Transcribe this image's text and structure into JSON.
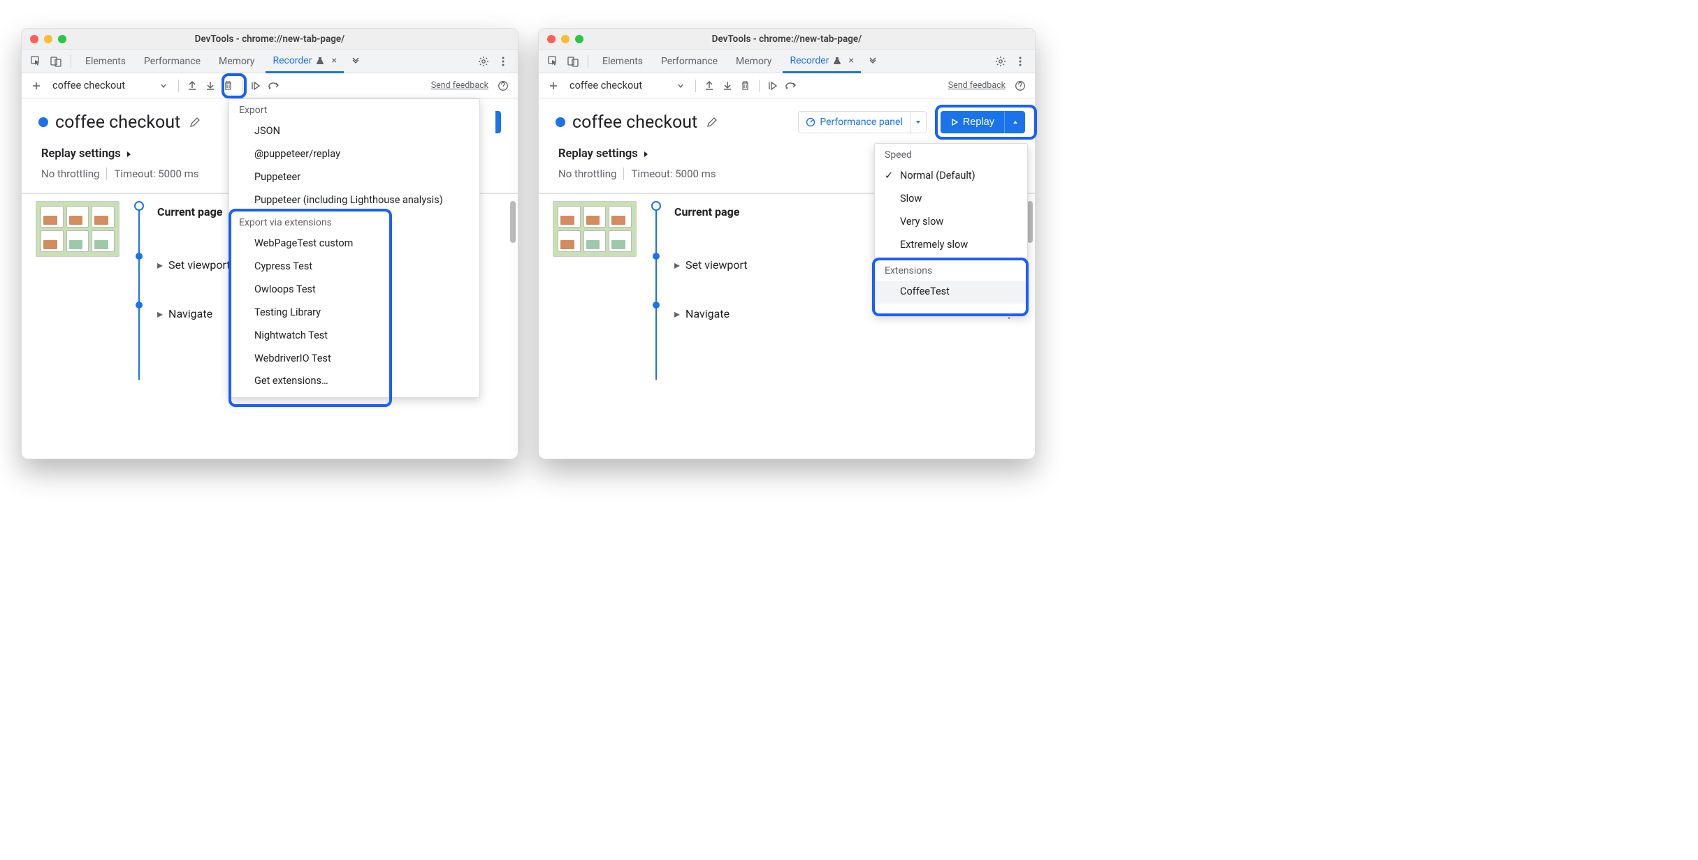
{
  "titlebar": {
    "title": "DevTools - chrome://new-tab-page/"
  },
  "tabs": {
    "elements": "Elements",
    "performance": "Performance",
    "memory": "Memory",
    "recorder": "Recorder"
  },
  "toolbar": {
    "recording_name": "coffee checkout",
    "send_feedback": "Send feedback"
  },
  "heading": {
    "title": "coffee checkout",
    "perf_panel": "Performance panel",
    "replay_label": "Replay"
  },
  "settings": {
    "title": "Replay settings",
    "throttling": "No throttling",
    "timeout": "Timeout: 5000 ms"
  },
  "steps": {
    "current_page": "Current page",
    "set_viewport": "Set viewport",
    "navigate": "Navigate"
  },
  "export_menu": {
    "section_export": "Export",
    "json": "JSON",
    "puppeteer_replay": "@puppeteer/replay",
    "puppeteer": "Puppeteer",
    "puppeteer_lh": "Puppeteer (including Lighthouse analysis)",
    "section_ext": "Export via extensions",
    "webpagetest": "WebPageTest custom",
    "cypress": "Cypress Test",
    "owloops": "Owloops Test",
    "testing_library": "Testing Library",
    "nightwatch": "Nightwatch Test",
    "webdriverio": "WebdriverIO Test",
    "get_extensions": "Get extensions…"
  },
  "replay_menu": {
    "section_speed": "Speed",
    "normal": "Normal (Default)",
    "slow": "Slow",
    "very_slow": "Very slow",
    "extremely_slow": "Extremely slow",
    "section_ext": "Extensions",
    "coffeetest": "CoffeeTest"
  }
}
